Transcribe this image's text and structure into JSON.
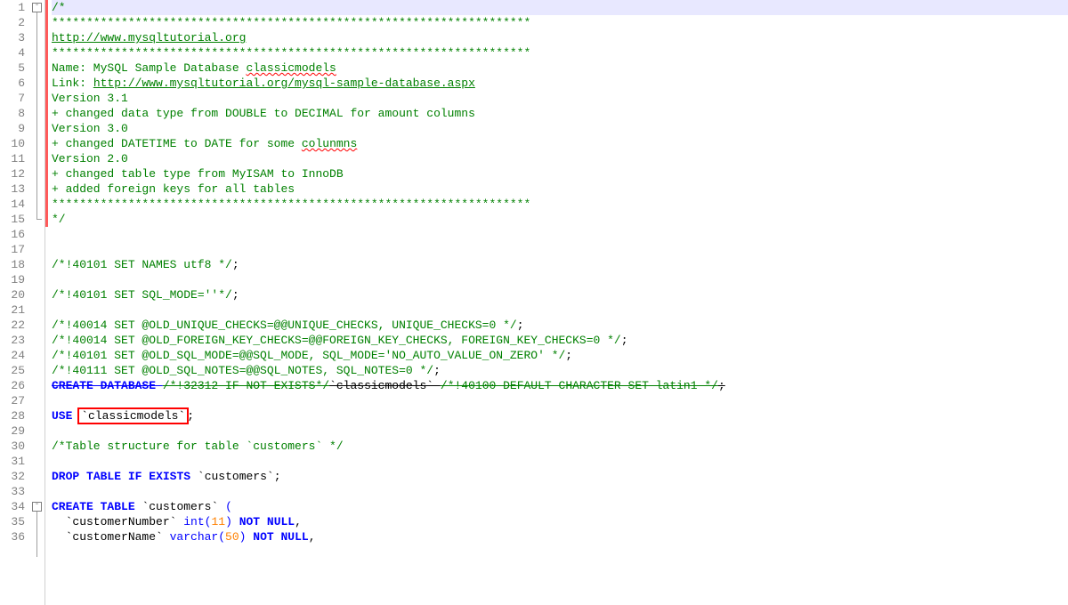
{
  "editor": {
    "annotation_box_text": "`classicmodels`",
    "highlight_row_index": 0,
    "lines": [
      {
        "n": 1,
        "parts": [
          {
            "t": "/*",
            "c": "c-comment"
          }
        ]
      },
      {
        "n": 2,
        "parts": [
          {
            "t": "*********************************************************************",
            "c": "c-comment"
          }
        ]
      },
      {
        "n": 3,
        "parts": [
          {
            "t": "http://www.mysqltutorial.org",
            "c": "c-comment link"
          }
        ]
      },
      {
        "n": 4,
        "parts": [
          {
            "t": "*********************************************************************",
            "c": "c-comment"
          }
        ]
      },
      {
        "n": 5,
        "parts": [
          {
            "t": "Name: MySQL Sample Database ",
            "c": "c-comment"
          },
          {
            "t": "classicmodels",
            "c": "c-comment wavy"
          }
        ]
      },
      {
        "n": 6,
        "parts": [
          {
            "t": "Link: ",
            "c": "c-comment"
          },
          {
            "t": "http://www.mysqltutorial.org/mysql-sample-database.aspx",
            "c": "c-comment link"
          }
        ]
      },
      {
        "n": 7,
        "parts": [
          {
            "t": "Version 3.1",
            "c": "c-comment"
          }
        ]
      },
      {
        "n": 8,
        "parts": [
          {
            "t": "+ changed data type from DOUBLE to DECIMAL for amount columns",
            "c": "c-comment"
          }
        ]
      },
      {
        "n": 9,
        "parts": [
          {
            "t": "Version 3.0",
            "c": "c-comment"
          }
        ]
      },
      {
        "n": 10,
        "parts": [
          {
            "t": "+ changed DATETIME to DATE for some ",
            "c": "c-comment"
          },
          {
            "t": "colunmns",
            "c": "c-comment wavy"
          }
        ]
      },
      {
        "n": 11,
        "parts": [
          {
            "t": "Version 2.0",
            "c": "c-comment"
          }
        ]
      },
      {
        "n": 12,
        "parts": [
          {
            "t": "+ changed table type from MyISAM to InnoDB",
            "c": "c-comment"
          }
        ]
      },
      {
        "n": 13,
        "parts": [
          {
            "t": "+ added foreign keys for all tables",
            "c": "c-comment"
          }
        ]
      },
      {
        "n": 14,
        "parts": [
          {
            "t": "*********************************************************************",
            "c": "c-comment"
          }
        ]
      },
      {
        "n": 15,
        "parts": [
          {
            "t": "*/",
            "c": "c-comment"
          }
        ]
      },
      {
        "n": 16,
        "parts": []
      },
      {
        "n": 17,
        "parts": []
      },
      {
        "n": 18,
        "parts": [
          {
            "t": "/*!40101 SET NAMES utf8 */",
            "c": "c-comment"
          },
          {
            "t": ";",
            "c": "c-txt"
          }
        ]
      },
      {
        "n": 19,
        "parts": []
      },
      {
        "n": 20,
        "parts": [
          {
            "t": "/*!40101 SET SQL_MODE=''*/",
            "c": "c-comment"
          },
          {
            "t": ";",
            "c": "c-txt"
          }
        ]
      },
      {
        "n": 21,
        "parts": []
      },
      {
        "n": 22,
        "parts": [
          {
            "t": "/*!40014 SET @OLD_UNIQUE_CHECKS=@@UNIQUE_CHECKS, UNIQUE_CHECKS=0 */",
            "c": "c-comment"
          },
          {
            "t": ";",
            "c": "c-txt"
          }
        ]
      },
      {
        "n": 23,
        "parts": [
          {
            "t": "/*!40014 SET @OLD_FOREIGN_KEY_CHECKS=@@FOREIGN_KEY_CHECKS, FOREIGN_KEY_CHECKS=0 */",
            "c": "c-comment"
          },
          {
            "t": ";",
            "c": "c-txt"
          }
        ]
      },
      {
        "n": 24,
        "parts": [
          {
            "t": "/*!40101 SET @OLD_SQL_MODE=@@SQL_MODE, SQL_MODE='NO_AUTO_VALUE_ON_ZERO' */",
            "c": "c-comment"
          },
          {
            "t": ";",
            "c": "c-txt"
          }
        ]
      },
      {
        "n": 25,
        "parts": [
          {
            "t": "/*!40111 SET @OLD_SQL_NOTES=@@SQL_NOTES, SQL_NOTES=0 */",
            "c": "c-comment"
          },
          {
            "t": ";",
            "c": "c-txt"
          }
        ]
      },
      {
        "n": 26,
        "parts": [
          {
            "t": "CREATE DATABASE ",
            "c": "c-kw strike"
          },
          {
            "t": "/*!32312 IF NOT EXISTS*/",
            "c": "c-comment strike"
          },
          {
            "t": "`classicmodels` ",
            "c": "c-txt strike"
          },
          {
            "t": "/*!40100 DEFAULT CHARACTER SET latin1 */",
            "c": "c-comment strike"
          },
          {
            "t": ";",
            "c": "c-txt strike"
          }
        ]
      },
      {
        "n": 27,
        "parts": []
      },
      {
        "n": 28,
        "parts": [
          {
            "t": "USE",
            "c": "c-kw"
          },
          {
            "t": " ",
            "c": "c-txt"
          },
          {
            "t": "`classicmodels`",
            "c": "c-txt",
            "box": true
          },
          {
            "t": ";",
            "c": "c-txt"
          }
        ]
      },
      {
        "n": 29,
        "parts": []
      },
      {
        "n": 30,
        "parts": [
          {
            "t": "/*Table structure for table `customers` */",
            "c": "c-comment"
          }
        ]
      },
      {
        "n": 31,
        "parts": []
      },
      {
        "n": 32,
        "parts": [
          {
            "t": "DROP",
            "c": "c-kw"
          },
          {
            "t": " ",
            "c": "c-txt"
          },
          {
            "t": "TABLE",
            "c": "c-kw"
          },
          {
            "t": " ",
            "c": "c-txt"
          },
          {
            "t": "IF",
            "c": "c-kw"
          },
          {
            "t": " ",
            "c": "c-txt"
          },
          {
            "t": "EXISTS",
            "c": "c-kw"
          },
          {
            "t": " `customers`;",
            "c": "c-txt"
          }
        ]
      },
      {
        "n": 33,
        "parts": []
      },
      {
        "n": 34,
        "parts": [
          {
            "t": "CREATE",
            "c": "c-kw"
          },
          {
            "t": " ",
            "c": "c-txt"
          },
          {
            "t": "TABLE",
            "c": "c-kw"
          },
          {
            "t": " `customers` ",
            "c": "c-txt"
          },
          {
            "t": "(",
            "c": "c-kw2"
          }
        ],
        "fold": true
      },
      {
        "n": 35,
        "parts": [
          {
            "t": "  `customerNumber` ",
            "c": "c-txt"
          },
          {
            "t": "int",
            "c": "c-kw2"
          },
          {
            "t": "(",
            "c": "c-kw2"
          },
          {
            "t": "11",
            "c": "c-num"
          },
          {
            "t": ")",
            "c": "c-kw2"
          },
          {
            "t": " ",
            "c": "c-txt"
          },
          {
            "t": "NOT",
            "c": "c-kw"
          },
          {
            "t": " ",
            "c": "c-txt"
          },
          {
            "t": "NULL",
            "c": "c-kw"
          },
          {
            "t": ",",
            "c": "c-txt"
          }
        ]
      },
      {
        "n": 36,
        "parts": [
          {
            "t": "  `customerName` ",
            "c": "c-txt"
          },
          {
            "t": "varchar",
            "c": "c-kw2"
          },
          {
            "t": "(",
            "c": "c-kw2"
          },
          {
            "t": "50",
            "c": "c-num"
          },
          {
            "t": ")",
            "c": "c-kw2"
          },
          {
            "t": " ",
            "c": "c-txt"
          },
          {
            "t": "NOT",
            "c": "c-kw"
          },
          {
            "t": " ",
            "c": "c-txt"
          },
          {
            "t": "NULL",
            "c": "c-kw"
          },
          {
            "t": ",",
            "c": "c-txt"
          }
        ]
      }
    ]
  }
}
